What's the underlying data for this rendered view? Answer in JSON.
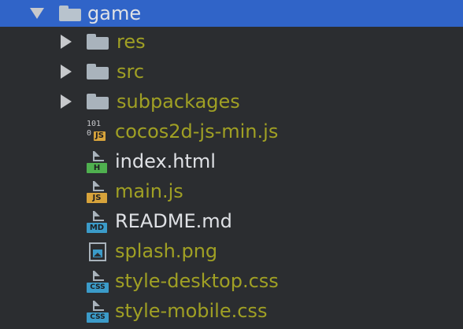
{
  "tree": {
    "root": {
      "label": "game",
      "expanded": true,
      "icon": "folder-icon"
    },
    "children": [
      {
        "label": "res",
        "type": "folder",
        "icon": "folder-icon",
        "color": "#a0a024"
      },
      {
        "label": "src",
        "type": "folder",
        "icon": "folder-icon",
        "color": "#a0a024"
      },
      {
        "label": "subpackages",
        "type": "folder",
        "icon": "folder-icon",
        "color": "#a0a024"
      },
      {
        "label": "cocos2d-js-min.js",
        "type": "file",
        "icon": "binary-js-file-icon",
        "badge": "JS",
        "binary_top": "101",
        "binary_bottom": "0",
        "color": "#a0a024"
      },
      {
        "label": "index.html",
        "type": "file",
        "icon": "html-file-icon",
        "badge": "H",
        "color": "#dfe1e5"
      },
      {
        "label": "main.js",
        "type": "file",
        "icon": "js-file-icon",
        "badge": "JS",
        "color": "#a0a024"
      },
      {
        "label": "README.md",
        "type": "file",
        "icon": "markdown-file-icon",
        "badge": "MD",
        "color": "#dfe1e5"
      },
      {
        "label": "splash.png",
        "type": "file",
        "icon": "image-file-icon",
        "color": "#a0a024"
      },
      {
        "label": "style-desktop.css",
        "type": "file",
        "icon": "css-file-icon",
        "badge": "CSS",
        "color": "#a0a024"
      },
      {
        "label": "style-mobile.css",
        "type": "file",
        "icon": "css-file-icon",
        "badge": "CSS",
        "color": "#a0a024"
      }
    ]
  },
  "colors": {
    "background": "#2b2d30",
    "selection": "#3064c8",
    "modified_text": "#a0a024",
    "normal_text": "#dfe1e5"
  }
}
